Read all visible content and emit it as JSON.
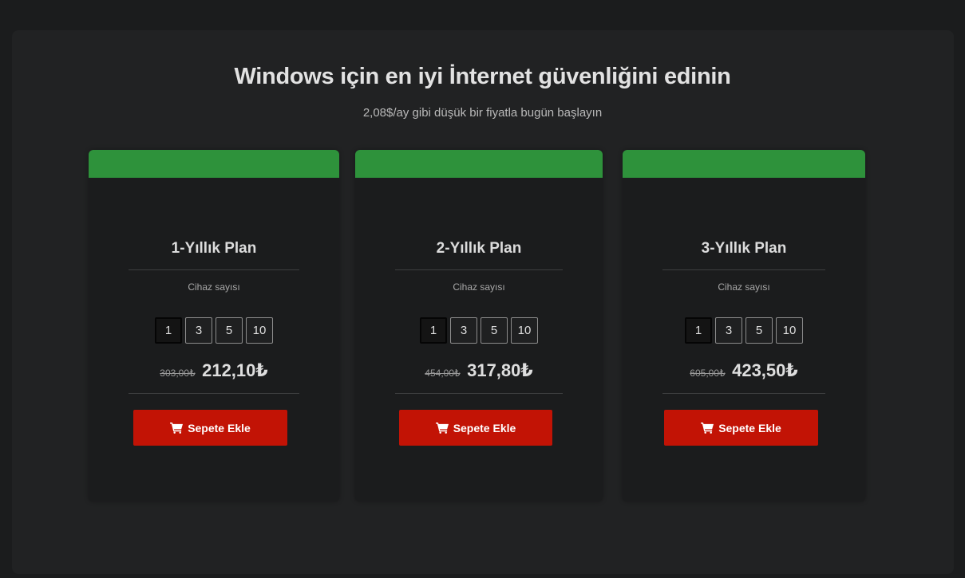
{
  "header": {
    "title": "Windows için en iyi İnternet güvenliğini edinin",
    "subtitle": "2,08$/ay gibi düşük bir fiyatla bugün başlayın"
  },
  "plans": [
    {
      "title": "1-Yıllık Plan",
      "device_label": "Cihaz sayısı",
      "device_options": [
        "1",
        "3",
        "5",
        "10"
      ],
      "selected_devices": "1",
      "old_price": "303,00₺",
      "new_price": "212,10₺",
      "button_label": "Sepete Ekle",
      "button_icon": "cart-icon"
    },
    {
      "title": "2-Yıllık Plan",
      "device_label": "Cihaz sayısı",
      "device_options": [
        "1",
        "3",
        "5",
        "10"
      ],
      "selected_devices": "1",
      "old_price": "454,00₺",
      "new_price": "317,80₺",
      "button_label": "Sepete Ekle",
      "button_icon": "cart-icon"
    },
    {
      "title": "3-Yıllık Plan",
      "device_label": "Cihaz sayısı",
      "device_options": [
        "1",
        "3",
        "5",
        "10"
      ],
      "selected_devices": "1",
      "old_price": "605,00₺",
      "new_price": "423,50₺",
      "button_label": "Sepete Ekle",
      "button_icon": "cart-icon"
    }
  ],
  "colors": {
    "page_background": "#1b1c1d",
    "panel_background": "#212223",
    "card_header": "#2e923b",
    "button": "#c21305"
  }
}
